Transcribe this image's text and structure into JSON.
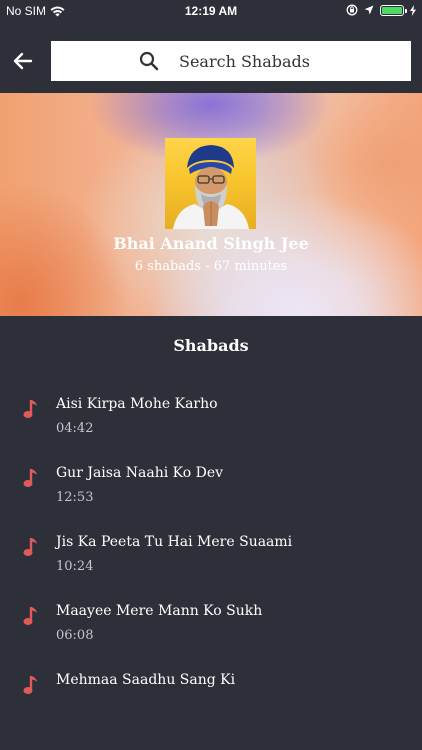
{
  "status_bar": {
    "carrier": "No SIM",
    "time": "12:19 AM",
    "icons": [
      "wifi-icon",
      "orientation-lock-icon",
      "location-icon",
      "battery-icon",
      "charging-icon"
    ],
    "battery_color": "#4cd964"
  },
  "header": {
    "back_icon": "arrow-left-icon",
    "search": {
      "placeholder": "Search Shabads",
      "value": "",
      "icon": "search-icon"
    }
  },
  "artist": {
    "name": "Bhai Anand Singh Jee",
    "summary": "6 shabads - 67 minutes"
  },
  "list": {
    "title": "Shabads",
    "accent_color": "#e05a5a",
    "items": [
      {
        "title": "Aisi Kirpa Mohe Karho",
        "duration": "04:42",
        "icon": "music-note-icon"
      },
      {
        "title": "Gur Jaisa Naahi Ko Dev",
        "duration": "12:53",
        "icon": "music-note-icon"
      },
      {
        "title": "Jis Ka Peeta Tu Hai Mere Suaami",
        "duration": "10:24",
        "icon": "music-note-icon"
      },
      {
        "title": "Maayee Mere Mann Ko Sukh",
        "duration": "06:08",
        "icon": "music-note-icon"
      },
      {
        "title": "Mehmaa Saadhu Sang Ki",
        "duration": "",
        "icon": "music-note-icon"
      }
    ]
  },
  "colors": {
    "background": "#2d3038",
    "text": "#ffffff",
    "secondary_text": "#c3c6cc"
  }
}
